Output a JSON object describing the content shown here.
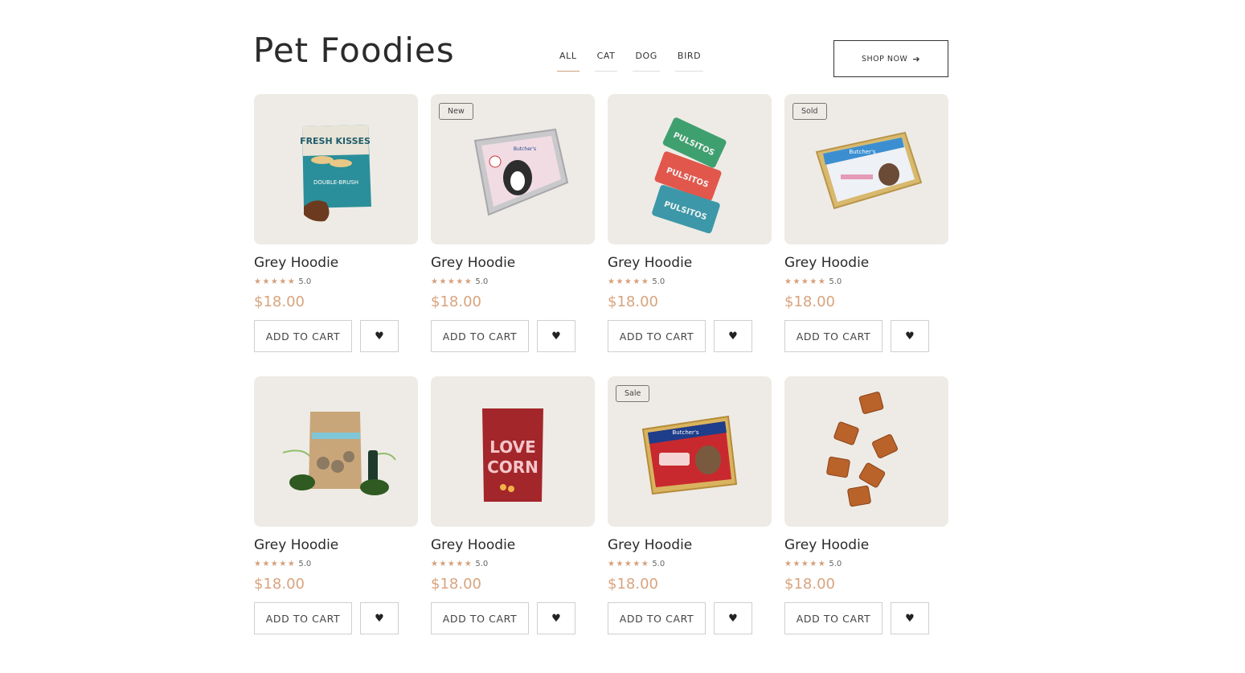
{
  "header": {
    "title": "Pet Foodies",
    "tabs": [
      {
        "label": "ALL",
        "active": true
      },
      {
        "label": "CAT",
        "active": false
      },
      {
        "label": "DOG",
        "active": false
      },
      {
        "label": "BIRD",
        "active": false
      }
    ],
    "shop_now_label": "SHOP NOW",
    "shop_now_icon": "arrow-right-icon"
  },
  "colors": {
    "accent_price": "#d8a47e",
    "card_background": "#eeebe6",
    "star": "#d5a07c"
  },
  "products": [
    {
      "badge": "",
      "name": "Grey Hoodie",
      "stars": "★★★★★",
      "rating": "5.0",
      "price": "$18.00",
      "add_label": "ADD TO CART",
      "wish_icon": "heart-icon",
      "image": "fresh-kisses-treat-bag",
      "image_text": [
        "FRESH KISSES",
        "DOUBLE-BRUSH"
      ]
    },
    {
      "badge": "New",
      "name": "Grey Hoodie",
      "stars": "★★★★★",
      "rating": "5.0",
      "price": "$18.00",
      "add_label": "ADD TO CART",
      "wish_icon": "heart-icon",
      "image": "dog-food-tray-pink",
      "image_text": [
        "Butcher's"
      ]
    },
    {
      "badge": "",
      "name": "Grey Hoodie",
      "stars": "★★★★★",
      "rating": "5.0",
      "price": "$18.00",
      "add_label": "ADD TO CART",
      "wish_icon": "heart-icon",
      "image": "pulsitos-packs",
      "image_text": [
        "PULSITOS"
      ]
    },
    {
      "badge": "Sold",
      "name": "Grey Hoodie",
      "stars": "★★★★★",
      "rating": "5.0",
      "price": "$18.00",
      "add_label": "ADD TO CART",
      "wish_icon": "heart-icon",
      "image": "butchers-tray-blue",
      "image_text": [
        "Butcher's"
      ]
    },
    {
      "badge": "",
      "name": "Grey Hoodie",
      "stars": "★★★★★",
      "rating": "5.0",
      "price": "$18.00",
      "add_label": "ADD TO CART",
      "wish_icon": "heart-icon",
      "image": "kraft-treat-bag",
      "image_text": []
    },
    {
      "badge": "",
      "name": "Grey Hoodie",
      "stars": "★★★★★",
      "rating": "5.0",
      "price": "$18.00",
      "add_label": "ADD TO CART",
      "wish_icon": "heart-icon",
      "image": "love-corn-bag",
      "image_text": [
        "LOVE",
        "CORN"
      ]
    },
    {
      "badge": "Sale",
      "name": "Grey Hoodie",
      "stars": "★★★★★",
      "rating": "5.0",
      "price": "$18.00",
      "add_label": "ADD TO CART",
      "wish_icon": "heart-icon",
      "image": "butchers-tray-red",
      "image_text": [
        "Butcher's"
      ]
    },
    {
      "badge": "",
      "name": "Grey Hoodie",
      "stars": "★★★★★",
      "rating": "5.0",
      "price": "$18.00",
      "add_label": "ADD TO CART",
      "wish_icon": "heart-icon",
      "image": "butchers-chunks",
      "image_text": []
    }
  ]
}
